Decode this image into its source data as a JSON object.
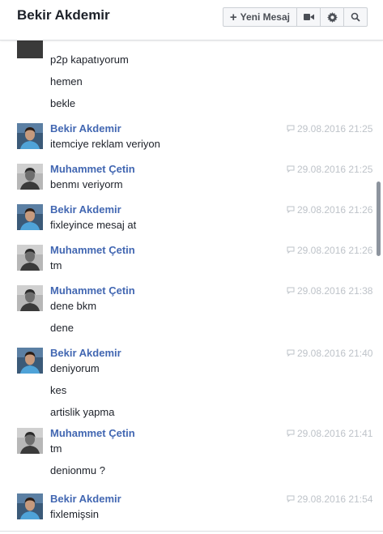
{
  "header": {
    "title": "Bekir Akdemir",
    "new_message_label": "Yeni Mesaj",
    "icons": [
      "video-icon",
      "gear-icon",
      "search-icon"
    ]
  },
  "colors": {
    "name": "#4267b2",
    "time": "#bec3c9",
    "text": "#1d2129"
  },
  "messages": [
    {
      "text": "p2p kapatıyorum"
    },
    {
      "text": "hemen"
    },
    {
      "text": "bekle"
    },
    {
      "sender": "Bekir Akdemir",
      "time": "29.08.2016 21:25",
      "text": "itemciye reklam veriyon"
    },
    {
      "sender": "Muhammet Çetin",
      "time": "29.08.2016 21:25",
      "text": "benmı veriyorm"
    },
    {
      "sender": "Bekir Akdemir",
      "time": "29.08.2016 21:26",
      "text": "fixleyince mesaj at"
    },
    {
      "sender": "Muhammet Çetin",
      "time": "29.08.2016 21:26",
      "text": "tm"
    },
    {
      "sender": "Muhammet Çetin",
      "time": "29.08.2016 21:38",
      "text": "dene bkm"
    },
    {
      "text": "dene"
    },
    {
      "sender": "Bekir Akdemir",
      "time": "29.08.2016 21:40",
      "text": "deniyorum"
    },
    {
      "text": "kes"
    },
    {
      "text": "artislik yapma"
    },
    {
      "sender": "Muhammet Çetin",
      "time": "29.08.2016 21:41",
      "text": "tm"
    },
    {
      "text": "denionmu ?"
    },
    {
      "sender": "Bekir Akdemir",
      "time": "29.08.2016 21:54",
      "text": "fixlemişsin"
    }
  ]
}
